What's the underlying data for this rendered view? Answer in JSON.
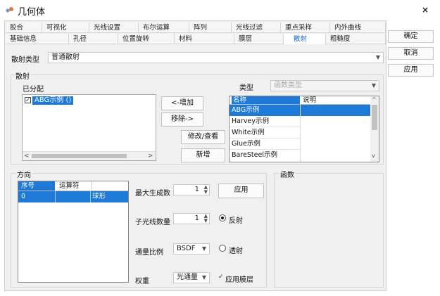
{
  "window": {
    "title": "几何体",
    "close_glyph": "×"
  },
  "tabs": {
    "row1": [
      "胶合",
      "可视化",
      "光线设置",
      "布尔运算",
      "阵列",
      "光线过滤",
      "重点采样",
      "内外曲线"
    ],
    "row2": [
      "基础信息",
      "孔径",
      "位置旋转",
      "材料",
      "膜层",
      "散射",
      "粗糙度"
    ],
    "active": "散射"
  },
  "side_buttons": {
    "ok": "确定",
    "cancel": "取消",
    "apply": "应用"
  },
  "scatter_type": {
    "label": "散射类型",
    "value": "普通散射"
  },
  "scatter_group": {
    "title": "散射",
    "assigned_label": "已分配",
    "assigned_item": "ABG示例 ()",
    "add_button": "<-增加",
    "remove_button": "移除->",
    "edit_button": "修改/查看",
    "new_button": "新增",
    "type_label": "类型",
    "type_value": "函数类型",
    "table_headers": [
      "名称",
      "说明"
    ],
    "table_rows": [
      "ABG示例",
      "Harvey示例",
      "White示例",
      "Glue示例",
      "BareSteel示例"
    ],
    "selected_row": "ABG示例"
  },
  "direction_group": {
    "title": "方向",
    "headers": [
      "序号",
      "运算符"
    ],
    "row": {
      "index": "0",
      "operator": "",
      "shape": "球形"
    }
  },
  "controls": {
    "max_gen_label": "最大生成数",
    "max_gen_value": "1",
    "apply_button": "应用",
    "child_rays_label": "子光线数量",
    "child_rays_value": "1",
    "reflect_label": "反射",
    "flux_ratio_label": "通量比例",
    "flux_ratio_value": "BSDF",
    "transmit_label": "透射",
    "weight_label": "权重",
    "weight_value": "光通量",
    "apply_film_label": "应用膜层"
  },
  "function_group": {
    "title": "函数"
  },
  "colors": {
    "selection": "#1e7ad6",
    "active_tab_text": "#1a64c8"
  }
}
